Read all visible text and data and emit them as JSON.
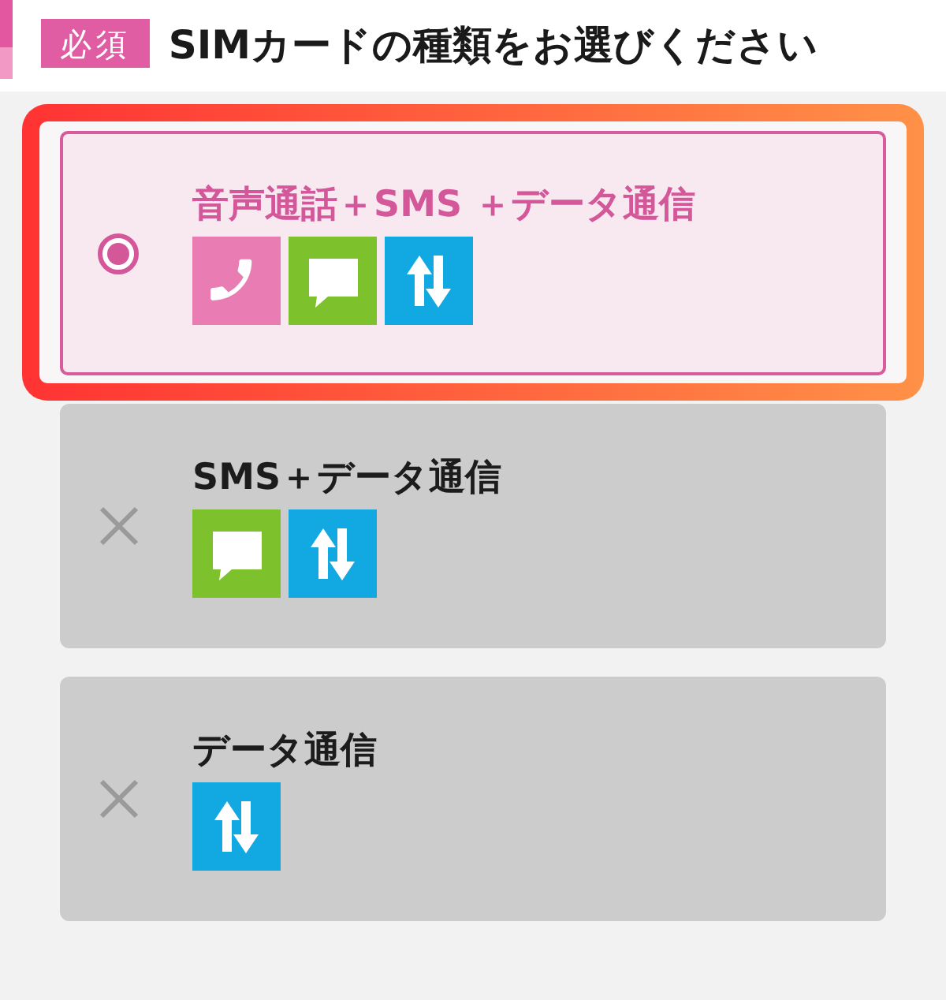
{
  "header": {
    "badge": "必須",
    "title": "SIMカードの種類をお選びください"
  },
  "options": [
    {
      "label": "音声通話＋SMS ＋データ通信",
      "selected": true,
      "disabled": false,
      "features": [
        {
          "kind": "voice"
        },
        {
          "kind": "sms"
        },
        {
          "kind": "data"
        }
      ]
    },
    {
      "label": "SMS＋データ通信",
      "selected": false,
      "disabled": true,
      "features": [
        {
          "kind": "sms"
        },
        {
          "kind": "data"
        }
      ]
    },
    {
      "label": "データ通信",
      "selected": false,
      "disabled": true,
      "features": [
        {
          "kind": "data"
        }
      ]
    }
  ]
}
